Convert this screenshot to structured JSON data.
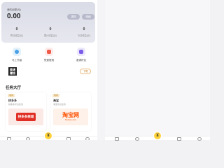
{
  "account": {
    "balance_label": "我的余额(元)",
    "balance": "0.00",
    "buttons": [
      "提现",
      "明细"
    ],
    "stats": [
      {
        "value": "0",
        "label": "昨日收益(元)"
      },
      {
        "value": "0",
        "label": "累计收益(元)"
      },
      {
        "value": "0",
        "label": "今日收益(元)"
      }
    ]
  },
  "quick_actions": [
    {
      "label": "马上升级",
      "icon": "upgrade-icon"
    },
    {
      "label": "快速提现",
      "icon": "withdraw-icon"
    },
    {
      "label": "邀请好友",
      "icon": "invite-icon"
    }
  ],
  "banner": {
    "text_line1": "邀请",
    "text_line2": "赚钱",
    "button": "下载"
  },
  "tasks_title": "任务大厅",
  "tasks": [
    {
      "tag": "电商",
      "name": "拼多多",
      "desc": "拼多多平台任务",
      "logo": "拼多多商城"
    },
    {
      "tag": "电商",
      "name": "淘宝",
      "desc": "淘宝平台任务",
      "logo": "淘宝网",
      "logo_sub": "Taobao.com"
    }
  ],
  "tabbar": {
    "center_icon": "yuan-icon",
    "center_glyph": "¥"
  },
  "colors": {
    "accent": "#ffd23a",
    "card_bg": "#dfe0e9",
    "pdd": "#e02e24",
    "taobao": "#ff5000"
  }
}
